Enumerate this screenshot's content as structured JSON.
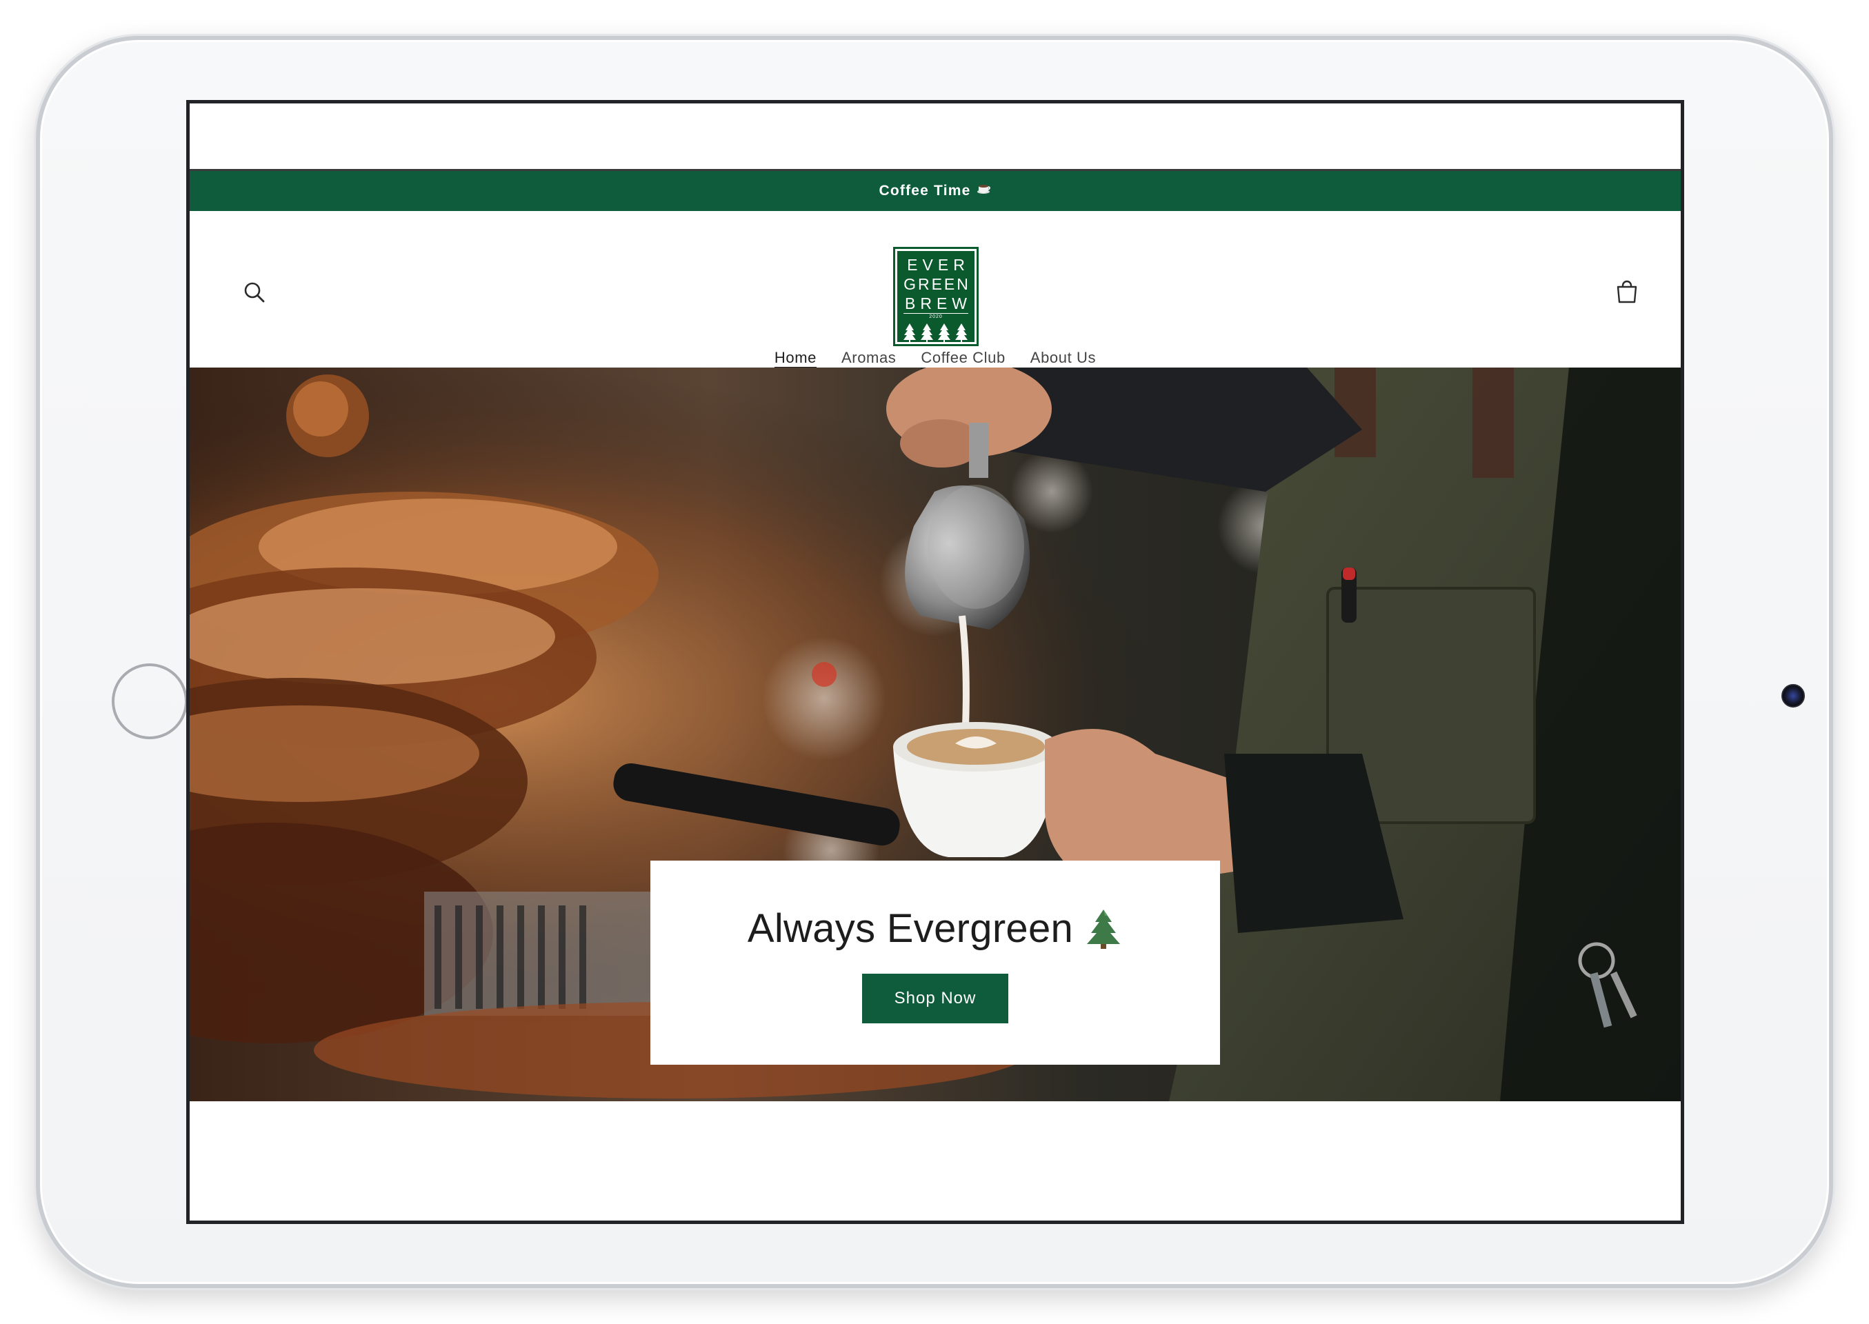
{
  "announcement": {
    "text": "Coffee Time"
  },
  "header": {
    "search_icon": "search-icon",
    "cart_icon": "cart-icon",
    "logo": {
      "line1": "EVER",
      "line2": "GREEN",
      "line3": "BREW",
      "est": "2020"
    }
  },
  "nav": {
    "items": [
      {
        "label": "Home",
        "active": true
      },
      {
        "label": "Aromas",
        "active": false
      },
      {
        "label": "Coffee Club",
        "active": false
      },
      {
        "label": "About Us",
        "active": false
      }
    ]
  },
  "hero": {
    "title": "Always Evergreen",
    "cta_label": "Shop Now"
  },
  "colors": {
    "brand_green": "#0f5c3c",
    "logo_green": "#0b5a2d",
    "text_dark": "#1d1d1d"
  }
}
